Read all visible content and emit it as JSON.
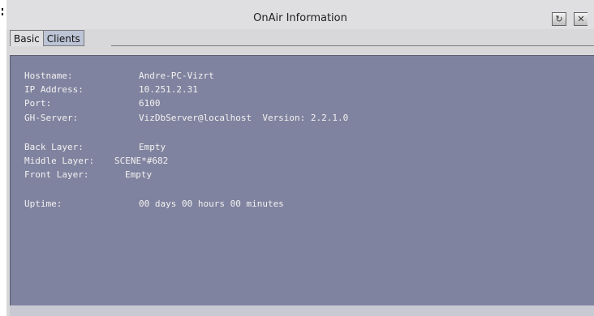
{
  "window": {
    "title": "OnAir Information"
  },
  "tabs": [
    {
      "label": "Basic",
      "active": true
    },
    {
      "label": "Clients",
      "active": false
    }
  ],
  "info": {
    "hostname_label": "Hostname:",
    "hostname_value": "Andre-PC-Vizrt",
    "ip_label": "IP Address:",
    "ip_value": "10.251.2.31",
    "port_label": "Port:",
    "port_value": "6100",
    "ghserver_label": "GH-Server:",
    "ghserver_value": "VizDbServer@localhost  Version: 2.2.1.0",
    "back_label": "Back Layer:",
    "back_value": "Empty",
    "middle_label": "Middle Layer:",
    "middle_value": "SCENE*#682",
    "front_label": "Front Layer:",
    "front_value": "Empty",
    "uptime_label": "Uptime:",
    "uptime_value": "00 days 00 hours 00 minutes"
  },
  "colors": {
    "panel": "#80839f",
    "text": "#f2f2f2",
    "tab_inactive": "#bcc4d6"
  }
}
